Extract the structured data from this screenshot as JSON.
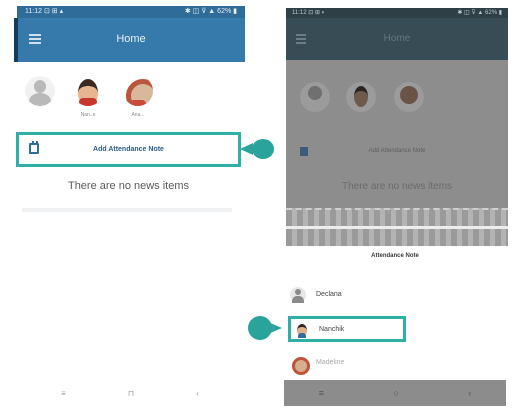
{
  "left_screen": {
    "status_bar": {
      "left": "11:12 ⊡ ⊞ ▴",
      "right": "✱ ◫ ⊽ ▲ 62% ▮"
    },
    "app_bar": {
      "title": "Home"
    },
    "children": [
      {
        "name": "",
        "icon": "default-avatar-icon"
      },
      {
        "name": "Nan..e",
        "icon": "boy-avatar-icon"
      },
      {
        "name": "Ana...",
        "icon": "girl-avatar-icon"
      }
    ],
    "attendance_button": {
      "label": "Add Attendance Note",
      "icon": "calendar-icon"
    },
    "empty_message": "There are no news items",
    "nav_bar": {
      "back": "≡",
      "home": "⊓",
      "recent": "‹"
    }
  },
  "right_screen": {
    "status_bar": {
      "left": "11:12 ⊡ ⊞ ◐",
      "right": "✱ ◫ ⊽ ▲ 62% ▮"
    },
    "app_bar": {
      "title": "Home"
    },
    "attendance_button": {
      "label": "Add Attendance Note"
    },
    "empty_message": "There are no news items",
    "sheet": {
      "title": "Attendance Note",
      "children": [
        {
          "name": "Declana",
          "icon": "default-avatar-icon"
        },
        {
          "name": "Nanchik",
          "icon": "boy-avatar-icon"
        },
        {
          "name": "Madeline",
          "icon": "girl-avatar-icon"
        }
      ]
    },
    "nav_bar": {
      "back": "≡",
      "home": "○",
      "recent": "‹"
    }
  },
  "colors": {
    "accent": "#2eb0a6",
    "primary": "#357aaa"
  }
}
